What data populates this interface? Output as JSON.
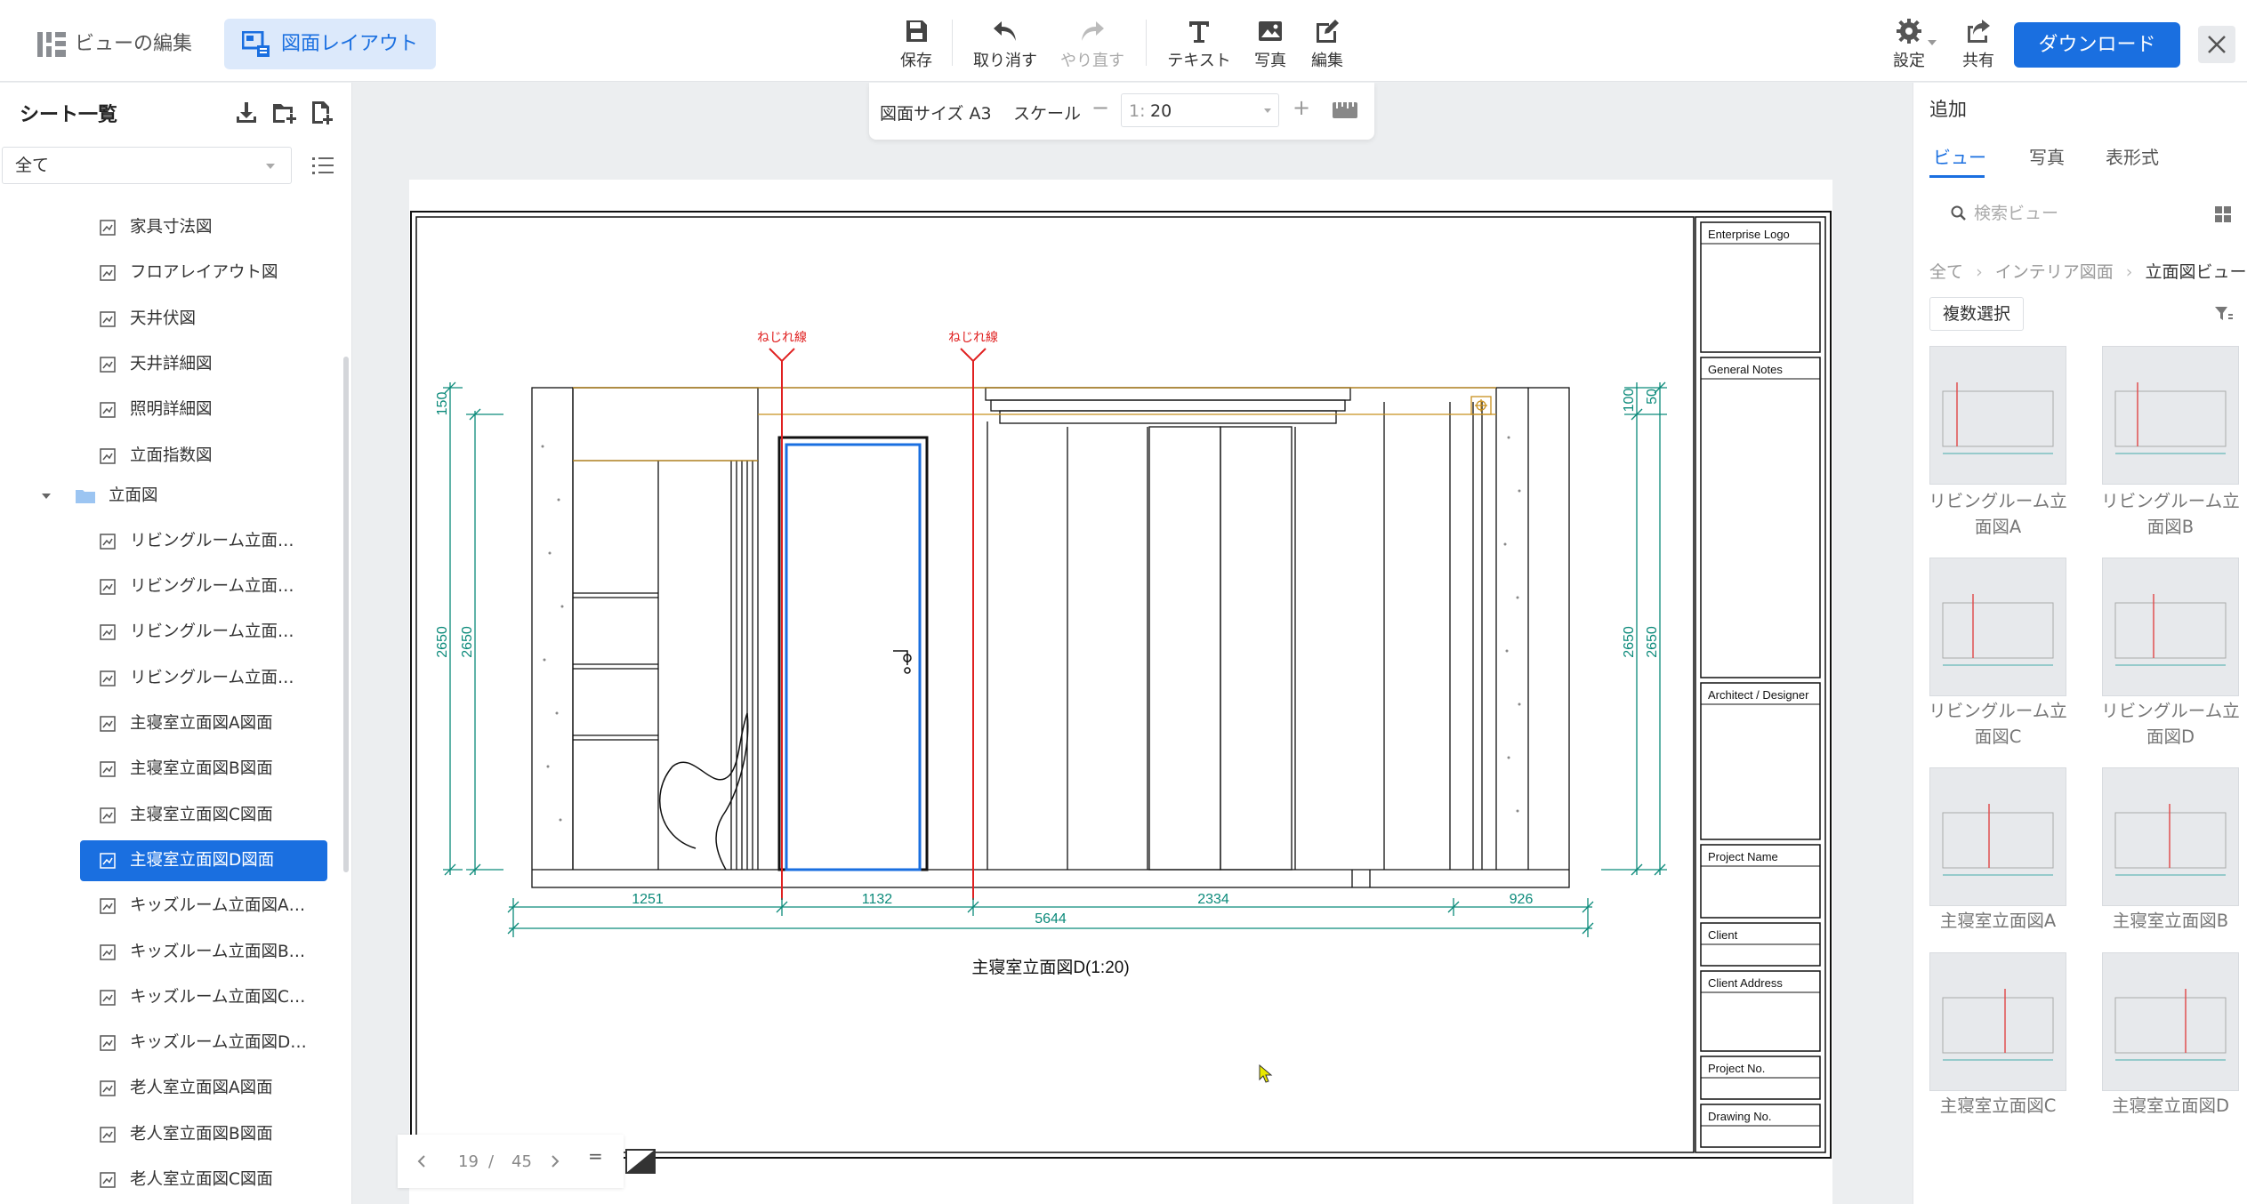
{
  "header": {
    "edit_view_label": "ビューの編集",
    "layout_tab_label": "図面レイアウト",
    "tools": [
      {
        "name": "save",
        "label": "保存",
        "enabled": true
      },
      {
        "name": "undo",
        "label": "取り消す",
        "enabled": true
      },
      {
        "name": "redo",
        "label": "やり直す",
        "enabled": false
      },
      {
        "name": "text",
        "label": "テキスト",
        "enabled": true
      },
      {
        "name": "photo",
        "label": "写真",
        "enabled": true
      },
      {
        "name": "edit",
        "label": "編集",
        "enabled": true
      }
    ],
    "settings_label": "設定",
    "share_label": "共有",
    "download_label": "ダウンロード",
    "accent_color": "#1a6fe0"
  },
  "sidebar": {
    "title": "シート一覧",
    "filter_value": "全て",
    "items": [
      "家具寸法図",
      "フロアレイアウト図",
      "天井伏図",
      "天井詳細図",
      "照明詳細図",
      "立面指数図"
    ],
    "folder_label": "立面図",
    "folder_items": [
      "リビングルーム立面…",
      "リビングルーム立面…",
      "リビングルーム立面…",
      "リビングルーム立面…",
      "主寝室立面図A図面",
      "主寝室立面図B図面",
      "主寝室立面図C図面",
      "主寝室立面図D図面",
      "キッズルーム立面図A…",
      "キッズルーム立面図B…",
      "キッズルーム立面図C…",
      "キッズルーム立面図D…",
      "老人室立面図A図面",
      "老人室立面図B図面",
      "老人室立面図C図面"
    ],
    "selected_item": "主寝室立面図D図面"
  },
  "canvas": {
    "sheet_size_label": "図面サイズ A3",
    "scale_label": "スケール",
    "scale_prefix": "1:",
    "scale_value": "20",
    "page_current": "19",
    "page_sep": "/",
    "page_total": "45",
    "page_equals": "="
  },
  "drawing": {
    "break_line_label": "ねじれ線",
    "caption": "主寝室立面図D(1:20)",
    "dims_bottom": [
      "1251",
      "1132",
      "2334",
      "926"
    ],
    "dims_total": "5644",
    "dims_left": [
      "150",
      "2650",
      "2650"
    ],
    "dims_right": [
      "100",
      "50",
      "2650",
      "2650"
    ],
    "title_block": [
      "Enterprise Logo",
      "General Notes",
      "Architect / Designer",
      "Project Name",
      "Client",
      "Client Address",
      "Project No.",
      "Drawing No."
    ]
  },
  "rpanel": {
    "title": "追加",
    "tabs": [
      "ビュー",
      "写真",
      "表形式"
    ],
    "active_tab": "ビュー",
    "search_placeholder": "検索ビュー",
    "crumbs": [
      "全て",
      "インテリア図面",
      "立面図ビュー"
    ],
    "multi_select_label": "複数選択",
    "thumbs": [
      {
        "label_line1": "リビングルーム立",
        "label_line2": "面図A"
      },
      {
        "label_line1": "リビングルーム立",
        "label_line2": "面図B"
      },
      {
        "label_line1": "リビングルーム立",
        "label_line2": "面図C"
      },
      {
        "label_line1": "リビングルーム立",
        "label_line2": "面図D"
      },
      {
        "label_line1": "主寝室立面図A",
        "label_line2": ""
      },
      {
        "label_line1": "主寝室立面図B",
        "label_line2": ""
      },
      {
        "label_line1": "主寝室立面図C",
        "label_line2": ""
      },
      {
        "label_line1": "主寝室立面図D",
        "label_line2": ""
      }
    ]
  }
}
